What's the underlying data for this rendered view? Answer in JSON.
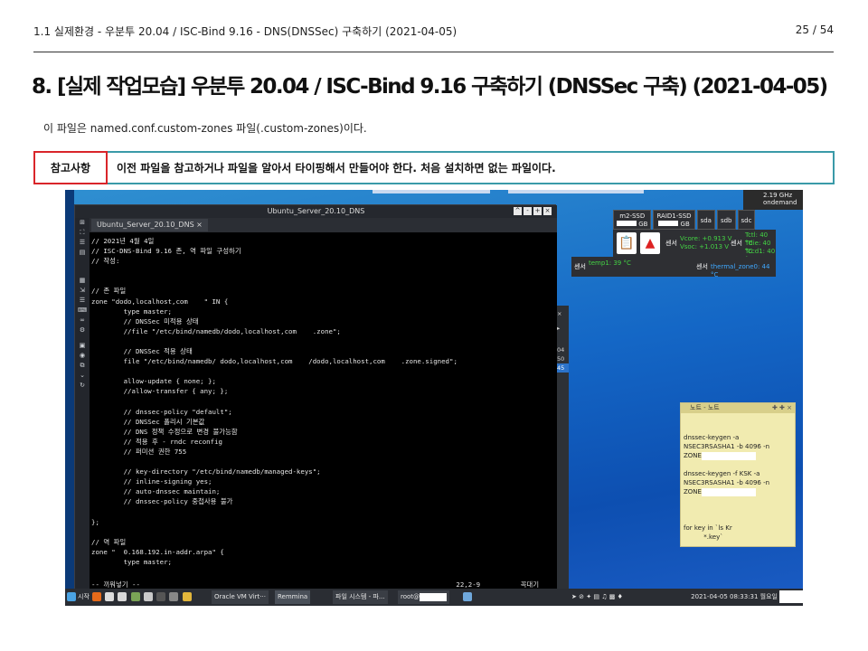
{
  "header": {
    "breadcrumb": "1.1 실제환경 - 우분투 20.04 / ISC-Bind 9.16 - DNS(DNSSec) 구축하기 (2021-04-05)",
    "page": "25 / 54"
  },
  "title": "8. [실제 작업모습] 우분투 20.04 / ISC-Bind 9.16 구축하기 (DNSSec 구축) (2021-04-05)",
  "subtitle": "이 파일은 named.conf.custom-zones 파일(.custom-zones)이다.",
  "note": {
    "label": "참고사항",
    "text": "이전 파일을 참고하거나 파일을 알아서 타이핑해서 만들어야 한다. 처음 설치하면 없는 파일이다."
  },
  "terminal": {
    "window_title": "Ubuntu_Server_20.10_DNS",
    "tab_label": "Ubuntu_Server_20.10_DNS ×",
    "lines": [
      "// 2021년 4월 4일",
      "// ISC-DNS-Bind 9.16 존, 역 파일 구성하기",
      "// 작성:",
      "",
      "",
      "// 존 파일",
      "zone \"dodo,localhost,com    \" IN {",
      "        type master;",
      "        // DNSSec 미적용 상태",
      "        //file \"/etc/bind/namedb/dodo,localhost,com    .zone\";",
      "",
      "        // DNSSec 적용 상태",
      "        file \"/etc/bind/namedb/ dodo,localhost,com    /dodo,localhost,com    .zone.signed\";",
      "",
      "        allow-update { none; };",
      "        //allow-transfer { any; };",
      "",
      "        // dnssec-policy \"default\";",
      "        // DNSSec 폴리시 기본값",
      "        // DNS 정책 수정으로 변경 불가능함",
      "        // 적용 후 - rndc reconfig",
      "        // 퍼미션 권한 755",
      "",
      "        // key-directory \"/etc/bind/namedb/managed-keys\";",
      "        // inline-signing yes;",
      "        // auto-dnssec maintain;",
      "        // dnssec-policy 중첩사용 불가",
      "",
      "};",
      "",
      "// 역 파일",
      "zone \"  0.168.192.in-addr.arpa\" {",
      "        type master;"
    ],
    "status_left": "-- 끼워넣기 --",
    "status_pos": "22,2-9",
    "status_right": "꼭대기",
    "side_partial": [
      "04",
      "50",
      "45"
    ]
  },
  "widgets": {
    "cpu_freq": "2.19 GHz",
    "cpu_mode": "ondemand",
    "disks": [
      {
        "name": "m2-SSD",
        "unit": "GB"
      },
      {
        "name": "RAID1-SSD",
        "unit": "GB"
      },
      {
        "name": "sda"
      },
      {
        "name": "sdb"
      },
      {
        "name": "sdc"
      }
    ],
    "sensor_label": "센서",
    "sensor_vals_1": [
      "Vcore: +0.913 V",
      "Vsoc: +1.013 V"
    ],
    "sensor_vals_2": [
      "Tctl: 40 °C",
      "Tdie: 40 °C",
      "Tccd1: 40 °C"
    ],
    "sensor_vals_3": [
      "temp1: 39 °C"
    ],
    "sensor_vals_4": [
      "thermal_zone0: 44 °C"
    ]
  },
  "sticky": {
    "title": "노트 - 노트",
    "lines": [
      "dnssec-keygen -a",
      "NSEC3RSASHA1 -b 4096 -n",
      "ZONE",
      "",
      "dnssec-keygen -f KSK -a",
      "NSEC3RSASHA1 -b 4096 -n",
      "ZONE",
      "",
      "",
      "",
      "for key in `ls Kr",
      "          *.key`"
    ]
  },
  "taskbar": {
    "start_label": "시작",
    "tasks": [
      "Oracle VM Virt···",
      "Remmina",
      "파일 시스템 - 파...",
      "root@"
    ],
    "clock": "2021-04-05 08:33:31 월요일"
  },
  "colors": {
    "note_label_border": "#d9252a",
    "note_text_border": "#3a9aa8",
    "desktop_blue": "#1467c6"
  }
}
